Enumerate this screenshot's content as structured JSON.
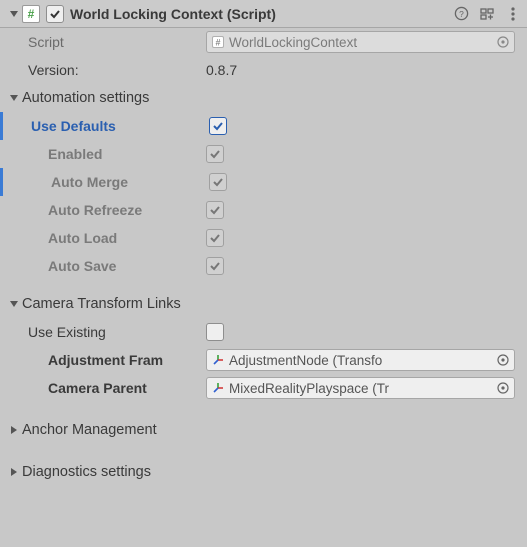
{
  "header": {
    "enabled": true,
    "title": "World Locking Context (Script)"
  },
  "script_row": {
    "label": "Script",
    "value": "WorldLockingContext"
  },
  "version_row": {
    "label": "Version:",
    "value": "0.8.7"
  },
  "automation": {
    "heading": "Automation settings",
    "use_defaults": {
      "label": "Use Defaults",
      "checked": true
    },
    "enabled": {
      "label": "Enabled",
      "checked": true
    },
    "auto_merge": {
      "label": "Auto Merge",
      "checked": true
    },
    "auto_refreeze": {
      "label": "Auto Refreeze",
      "checked": true
    },
    "auto_load": {
      "label": "Auto Load",
      "checked": true
    },
    "auto_save": {
      "label": "Auto Save",
      "checked": true
    }
  },
  "camera_links": {
    "heading": "Camera Transform Links",
    "use_existing": {
      "label": "Use Existing",
      "checked": false
    },
    "adjustment_frame": {
      "label": "Adjustment Fram",
      "value": "AdjustmentNode (Transfo"
    },
    "camera_parent": {
      "label": "Camera Parent",
      "value": "MixedRealityPlayspace (Tr"
    }
  },
  "anchor_section": {
    "heading": "Anchor Management"
  },
  "diag_section": {
    "heading": "Diagnostics settings"
  }
}
